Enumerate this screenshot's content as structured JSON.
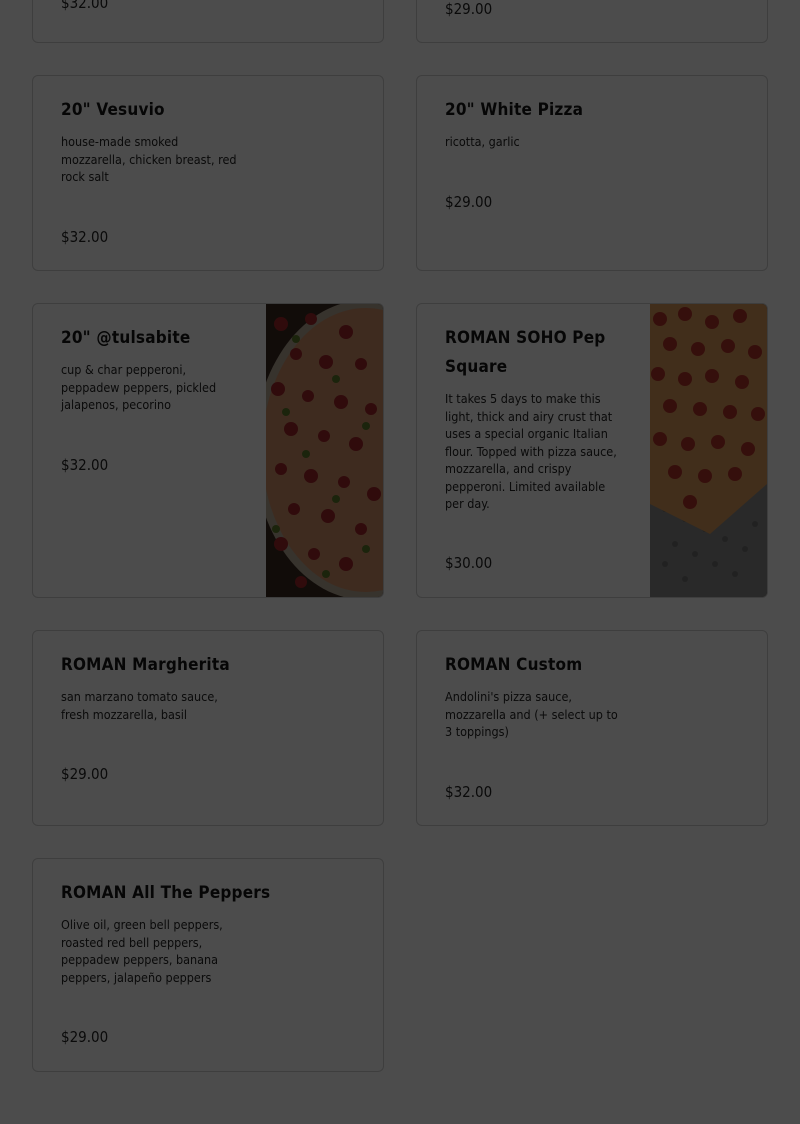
{
  "menu_items": [
    {
      "price": "$32.00"
    },
    {
      "price": "$29.00"
    },
    {
      "name": "20\" Vesuvio",
      "description": "house-made smoked mozzarella, chicken breast, red rock salt",
      "price": "$32.00"
    },
    {
      "name": "20\" White Pizza",
      "description": "ricotta, garlic",
      "price": "$29.00"
    },
    {
      "name": "20\" @tulsabite",
      "description": "cup & char pepperoni, peppadew peppers, pickled jalapenos, pecorino",
      "price": "$32.00",
      "image": "pizza-photo"
    },
    {
      "name": "ROMAN SOHO Pep Square",
      "description": "It takes 5 days to make this light, thick and airy crust that uses a special organic Italian flour. Topped with pizza sauce, mozzarella, and crispy pepperoni. Limited available per day.",
      "price": "$30.00",
      "image": "pizza-photo"
    },
    {
      "name": "ROMAN Margherita",
      "description": "san marzano tomato sauce, fresh mozzarella, basil",
      "price": "$29.00"
    },
    {
      "name": "ROMAN Custom",
      "description": "Andolini's pizza sauce, mozzarella and (+ select up to 3 toppings)",
      "price": "$32.00"
    },
    {
      "name": "ROMAN All The Peppers",
      "description": "Olive oil, green bell peppers, roasted red bell peppers, peppadew peppers, banana peppers, jalapeño peppers",
      "price": "$29.00"
    }
  ],
  "colors": {
    "overlay": "#000000b3",
    "card_border": "#cfcfcf",
    "text": "#151515"
  }
}
